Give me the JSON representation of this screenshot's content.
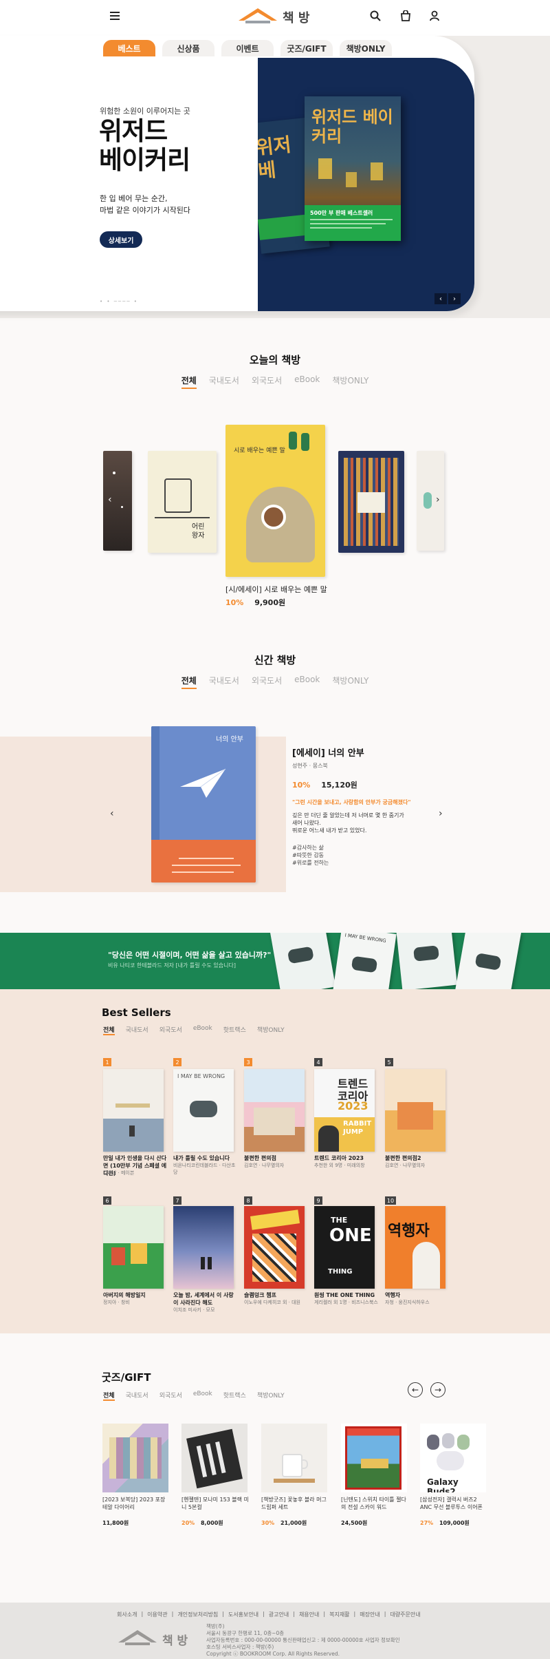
{
  "header": {
    "logo_text": "책 방"
  },
  "hero": {
    "tabs": [
      "베스트",
      "신상품",
      "이벤트",
      "굿즈/GIFT",
      "책방ONLY"
    ],
    "subtitle": "위험한 소원이 이루어지는 곳",
    "title_line1": "위저드",
    "title_line2": "베이커리",
    "desc_line1": "한 입 베어 무는 순간,",
    "desc_line2": "마법 같은 이야기가 시작된다",
    "button": "상세보기",
    "book_title": "위저드 베이커리",
    "book_band": "500만 부 판매 베스트셀러"
  },
  "today": {
    "title": "오늘의 책방",
    "filters": [
      "전체",
      "국내도서",
      "외국도서",
      "eBook",
      "책방ONLY"
    ],
    "featured_title": "[시/에세이] 시로 배우는 예쁜 말",
    "featured_discount": "10%",
    "featured_price": "9,900원",
    "cover_text": "시로 배우는 예쁜 말"
  },
  "newbooks": {
    "title": "신간 책방",
    "filters": [
      "전체",
      "국내도서",
      "외국도서",
      "eBook",
      "책방ONLY"
    ],
    "book_title": "[에세이] 너의 안부",
    "author": "성현주 · 몽스북",
    "discount": "10%",
    "price": "15,120원",
    "quote": "\"그런 시간을 보내고, 사랑함의 안부가 궁금해졌다\"",
    "desc_line1": "깊은 만 더딘 줄 알았는데 저 너머로 몇 한 줌기가",
    "desc_line2": "새어 나왔다.",
    "desc_line3": "뛰로운 어느새 내가 받고 있었다.",
    "tags": [
      "#감사하는 삶",
      "#따뜻한 감동",
      "#위로를 전하는"
    ],
    "cover_title": "너의 안부"
  },
  "banner": {
    "quote": "\"당신은 어떤 시절이며, 어떤 삶을 살고 있습니까?\"",
    "sub": "비유 나티코 한테블라드 저자 [내가 틀릴 수도 있습니다]",
    "book_text": "I MAY BE WRONG"
  },
  "bestsellers": {
    "title": "Best Sellers",
    "filters": [
      "전체",
      "국내도서",
      "외국도서",
      "eBook",
      "핫트랙스",
      "책방ONLY"
    ],
    "items": [
      {
        "rank": "1",
        "title": "만일 내가 인생을 다시 산다면 (10만부 기념 스페셜 에디션)",
        "author": "김혜남 · 메이븐"
      },
      {
        "rank": "2",
        "title": "내가 틀릴 수도 있습니다",
        "author": "비욘나티코린데블라드 · 다산초당"
      },
      {
        "rank": "3",
        "title": "불편한 편의점",
        "author": "김호연 · 나무옆의자"
      },
      {
        "rank": "4",
        "title": "트렌드 코리아 2023",
        "author": "추천한 외 9명 · 미래의창"
      },
      {
        "rank": "5",
        "title": "불편한 편의점2",
        "author": "김호연 · 나무옆의자"
      },
      {
        "rank": "6",
        "title": "아버지의 해방일지",
        "author": "정지아 · 창비"
      },
      {
        "rank": "7",
        "title": "오늘 밤, 세계에서 이 사랑이 사라진다 해도",
        "author": "이치조 미사키 · 모모"
      },
      {
        "rank": "8",
        "title": "슬램덩크 챔프",
        "author": "이노우에 다케히코 외 · 대원"
      },
      {
        "rank": "9",
        "title": "원씽 THE ONE THING",
        "author": "게리켈러 외 1명 · 비즈니스북스"
      },
      {
        "rank": "10",
        "title": "역행자",
        "author": "자청 · 웅진지식하우스"
      }
    ],
    "covers": {
      "c2": "I MAY BE WRONG",
      "c4a": "트렌드",
      "c4b": "코리아",
      "c4c": "2023",
      "c4d": "RABBIT",
      "c4e": "JUMP",
      "c9a": "THE",
      "c9b": "ONE",
      "c9c": "THING",
      "c10": "역행자"
    }
  },
  "goods": {
    "title": "굿즈/GIFT",
    "filters": [
      "전체",
      "국내도서",
      "외국도서",
      "eBook",
      "핫트랙스",
      "책방ONLY"
    ],
    "items": [
      {
        "name": "[2023 보복당] 2023 포장테알 다이어리",
        "discount": "",
        "price": "11,800원"
      },
      {
        "name": "[헨젤텐] 모나미 153 블랙 미니 5본컬",
        "discount": "20%",
        "price": "8,000원"
      },
      {
        "name": "[책방굿즈] 꽃놓후 블라 머그 드립퍼 세트",
        "discount": "30%",
        "price": "21,000원"
      },
      {
        "name": "[닌텐도] 스위치 타이틀 젤다의 전설 스카이 워드",
        "discount": "",
        "price": "24,500원"
      },
      {
        "name": "[삼성전자] 갤럭시 버즈2 ANC 무선 블루투스 이어폰",
        "discount": "27%",
        "price": "109,000원"
      }
    ],
    "buds_label": "Galaxy Buds2"
  },
  "footer": {
    "links": [
      "회사소개",
      "|",
      "이용약관",
      "|",
      "개인정보처리방침",
      "|",
      "도서홍보안내",
      "|",
      "광고안내",
      "|",
      "채용안내",
      "|",
      "복지재활",
      "|",
      "매장안내",
      "|",
      "대량주문안내"
    ],
    "logo_text": "책 방",
    "info": [
      "책방(주)",
      "서울시 동광구 한평로 11, 0층~0층",
      "사업자등록번호 : 000-00-00000  통신판매업신고 : 제 0000-00000호 사업자 정보확인",
      "호스팅 서비스사업자 : 책방(주)",
      "Copyright ⓒ BOOKROOM Corp. All Rights Reserved."
    ]
  },
  "colors": {
    "accent": "#f38b2f",
    "navy": "#132a55",
    "green": "#1b8553",
    "peach": "#f4e6dc"
  }
}
